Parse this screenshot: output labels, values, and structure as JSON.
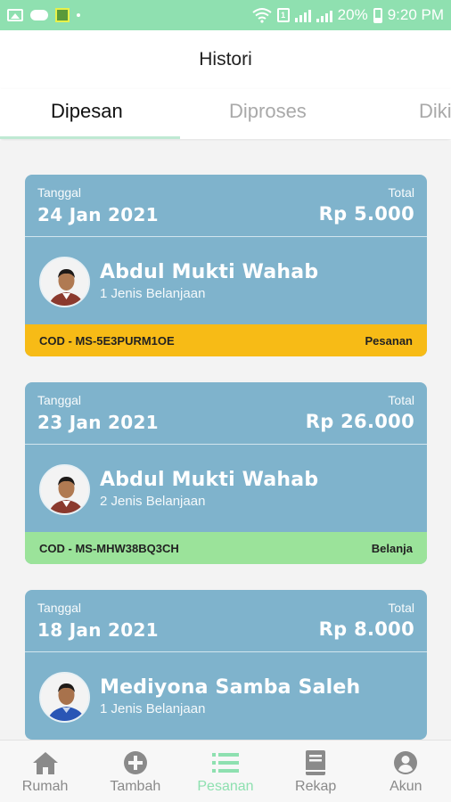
{
  "status_bar": {
    "battery": "20%",
    "time": "9:20 PM",
    "sim_label": "1"
  },
  "header": {
    "title": "Histori"
  },
  "tabs": [
    {
      "label": "Dipesan",
      "active": true
    },
    {
      "label": "Diproses",
      "active": false
    },
    {
      "label": "Dikirim",
      "active": false
    }
  ],
  "orders": [
    {
      "date_label": "Tanggal",
      "date": "24 Jan 2021",
      "total_label": "Total",
      "total": "Rp 5.000",
      "customer": "Abdul Mukti Wahab",
      "items": "1 Jenis Belanjaan",
      "code": "COD - MS-5E3PURM1OE",
      "status": "Pesanan",
      "status_color": "#f7bb16"
    },
    {
      "date_label": "Tanggal",
      "date": "23 Jan 2021",
      "total_label": "Total",
      "total": "Rp 26.000",
      "customer": "Abdul Mukti Wahab",
      "items": "2 Jenis Belanjaan",
      "code": "COD - MS-MHW38BQ3CH",
      "status": "Belanja",
      "status_color": "#9be39a"
    },
    {
      "date_label": "Tanggal",
      "date": "18 Jan 2021",
      "total_label": "Total",
      "total": "Rp 8.000",
      "customer": "Mediyona Samba Saleh",
      "items": "1 Jenis Belanjaan"
    }
  ],
  "bottom_nav": [
    {
      "label": "Rumah",
      "icon": "home-icon",
      "active": false
    },
    {
      "label": "Tambah",
      "icon": "add-circle-icon",
      "active": false
    },
    {
      "label": "Pesanan",
      "icon": "list-icon",
      "active": true
    },
    {
      "label": "Rekap",
      "icon": "book-icon",
      "active": false
    },
    {
      "label": "Akun",
      "icon": "account-icon",
      "active": false
    }
  ],
  "colors": {
    "accent": "#8ee0b0",
    "card": "#7fb3cc",
    "status_pesanan": "#f7bb16",
    "status_belanja": "#9be39a"
  }
}
